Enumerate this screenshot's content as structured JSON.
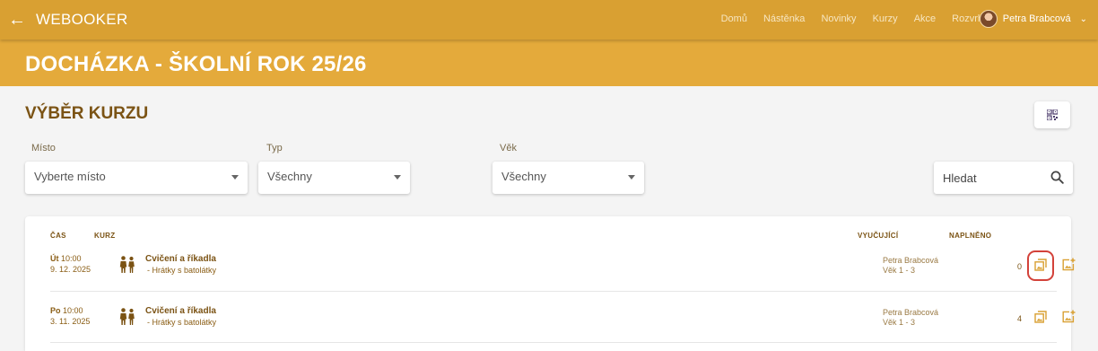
{
  "header": {
    "back_icon": "arrow-left-icon",
    "brand": "WEBOOKER",
    "nav": [
      "Domů",
      "Nástěnka",
      "Novinky",
      "Kurzy",
      "Akce",
      "Rozvrh"
    ],
    "user_name": "Petra Brabcová",
    "user_chevron_icon": "chevron-down-icon"
  },
  "banner": {
    "title": "DOCHÁZKA - ŠKOLNÍ ROK 25/26"
  },
  "section": {
    "title": "VÝBĚR KURZU",
    "qr_icon": "qr-code-icon"
  },
  "filters": {
    "place_label": "Místo",
    "place_value": "Vyberte místo",
    "type_label": "Typ",
    "type_value": "Všechny",
    "age_label": "Věk",
    "age_value": "Všechny",
    "search_placeholder": "Hledat",
    "search_icon": "search-icon"
  },
  "table": {
    "headers": {
      "time": "ČAS",
      "course": "KURZ",
      "teacher": "VYUČUJÍCÍ",
      "filled": "NAPLNĚNO"
    },
    "rows": [
      {
        "day": "Út",
        "time": "10:00",
        "date": "9. 12. 2025",
        "course": "Cvičení a říkadla",
        "subtitle": "- Hrátky s batolátky",
        "teacher": "Petra Brabcová",
        "age": "Věk 1 - 3",
        "count": "0",
        "highlighted": true
      },
      {
        "day": "Po",
        "time": "10:00",
        "date": "3. 11. 2025",
        "course": "Cvičení a říkadla",
        "subtitle": "- Hrátky s batolátky",
        "teacher": "Petra Brabcová",
        "age": "Věk 1 - 3",
        "count": "4",
        "highlighted": false
      }
    ]
  },
  "colors": {
    "topbar": "#d9a032",
    "banner": "#e4aa3b",
    "text_brown": "#7b5314",
    "icon_gold": "#d9a032",
    "highlight_red": "#d3423a",
    "qr_purple": "#4a3a6a"
  }
}
